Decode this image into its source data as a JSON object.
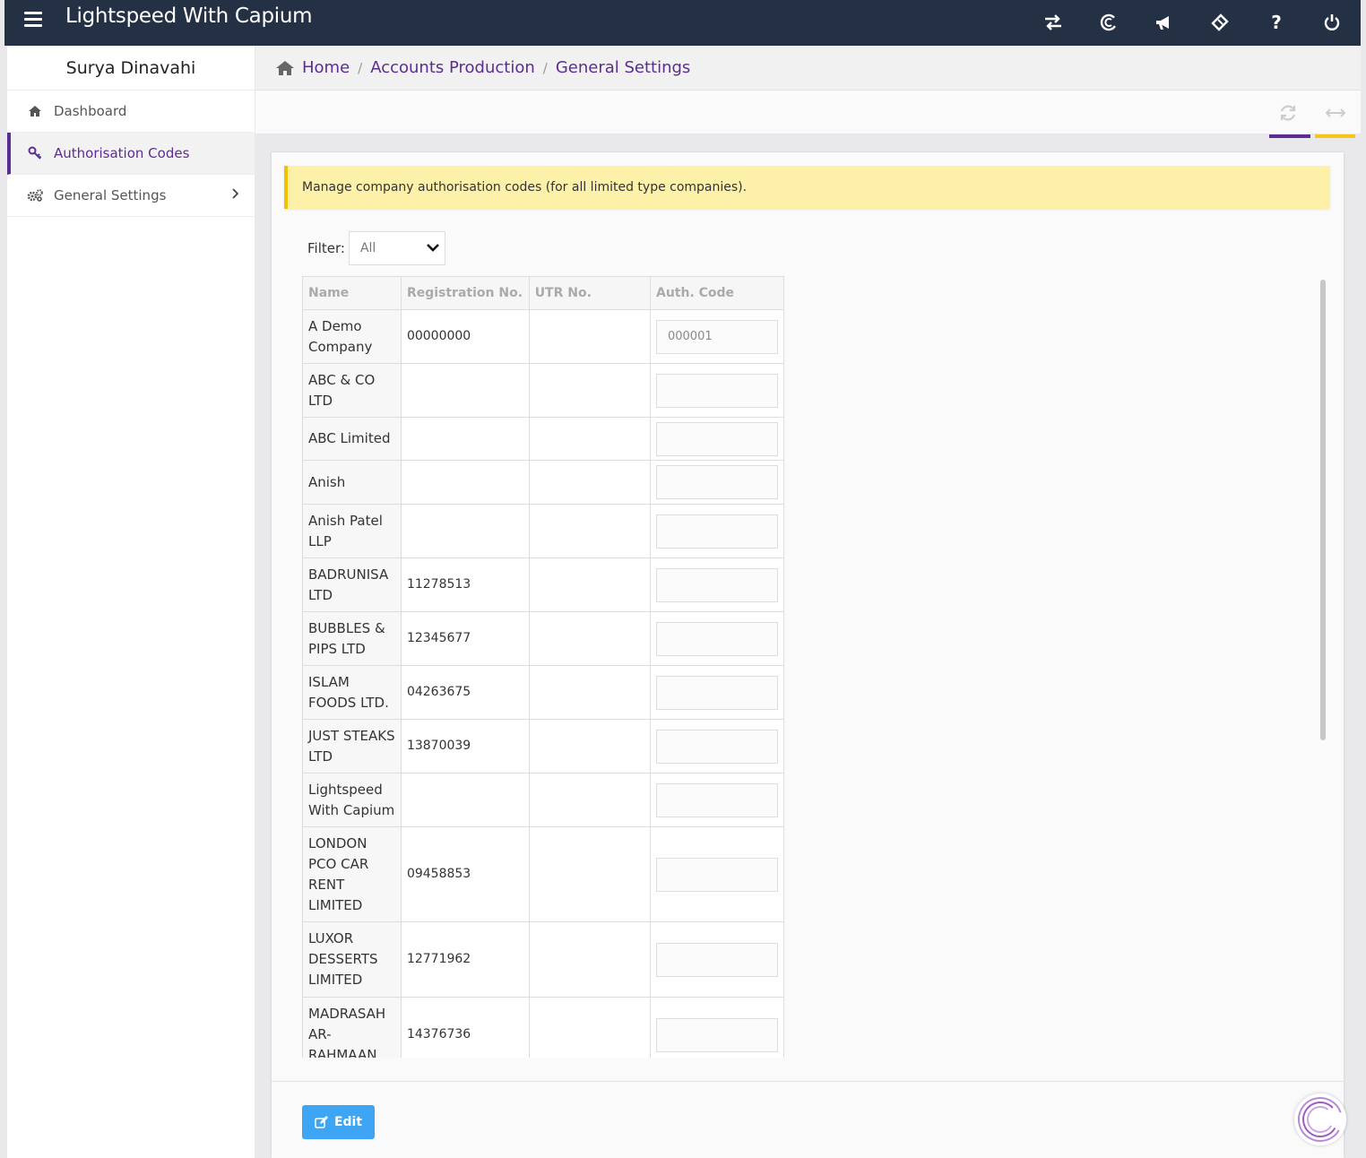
{
  "app": {
    "title": "Lightspeed With Capium"
  },
  "topbar": {
    "icons": [
      "swap-icon",
      "capium-c-icon",
      "megaphone-icon",
      "ticket-icon",
      "help-icon",
      "power-icon"
    ],
    "help_glyph": "?"
  },
  "sidebar": {
    "user_name": "Surya Dinavahi",
    "items": [
      {
        "label": "Dashboard",
        "icon": "home-icon",
        "active": false
      },
      {
        "label": "Authorisation Codes",
        "icon": "key-icon",
        "active": true
      },
      {
        "label": "General Settings",
        "icon": "gears-icon",
        "active": false,
        "has_children": true
      }
    ]
  },
  "breadcrumb": [
    "Home",
    "Accounts Production",
    "General Settings"
  ],
  "colors": {
    "brand_purple": "#5c2d91",
    "topbar": "#243044",
    "alert_bg": "#fdf0a8",
    "edit_button": "#3da5f4",
    "accent_yellow": "#f5c518"
  },
  "alert": {
    "message": "Manage company authorisation codes (for all limited type companies)."
  },
  "filter": {
    "label": "Filter:",
    "value": "All"
  },
  "table": {
    "columns": [
      "Name",
      "Registration No.",
      "UTR No.",
      "Auth. Code"
    ],
    "rows": [
      {
        "name": "A Demo Company",
        "reg": "00000000",
        "utr": "",
        "auth": "000001"
      },
      {
        "name": "ABC & CO LTD",
        "reg": "",
        "utr": "",
        "auth": ""
      },
      {
        "name": "ABC Limited",
        "reg": "",
        "utr": "",
        "auth": ""
      },
      {
        "name": "Anish",
        "reg": "",
        "utr": "",
        "auth": ""
      },
      {
        "name": "Anish Patel LLP",
        "reg": "",
        "utr": "",
        "auth": ""
      },
      {
        "name": "BADRUNISA LTD",
        "reg": "11278513",
        "utr": "",
        "auth": ""
      },
      {
        "name": "BUBBLES & PIPS LTD",
        "reg": "12345677",
        "utr": "",
        "auth": ""
      },
      {
        "name": "ISLAM FOODS LTD.",
        "reg": "04263675",
        "utr": "",
        "auth": ""
      },
      {
        "name": "JUST STEAKS LTD",
        "reg": "13870039",
        "utr": "",
        "auth": ""
      },
      {
        "name": "Lightspeed With Capium",
        "reg": "",
        "utr": "",
        "auth": ""
      },
      {
        "name": "LONDON PCO CAR RENT LIMITED",
        "reg": "09458853",
        "utr": "",
        "auth": ""
      },
      {
        "name": "LUXOR DESSERTS LIMITED",
        "reg": "12771962",
        "utr": "",
        "auth": ""
      },
      {
        "name": "MADRASAH AR-RAHMAAN",
        "reg": "14376736",
        "utr": "",
        "auth": ""
      }
    ]
  },
  "footer": {
    "edit_label": "Edit"
  }
}
